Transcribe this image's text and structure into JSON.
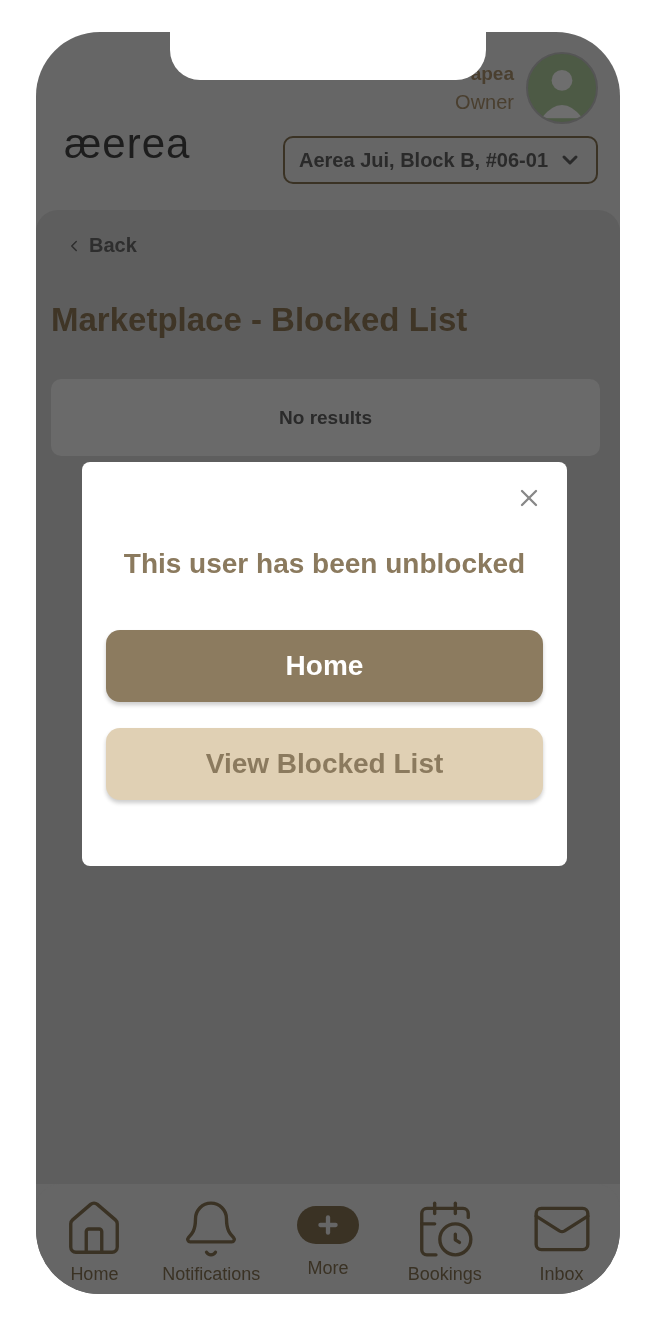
{
  "header": {
    "logo": "æerea",
    "user_name": "apea",
    "user_role": "Owner",
    "unit_selector": "Aerea Jui, Block B, #06-01"
  },
  "page": {
    "back": "Back",
    "title": "Marketplace - Blocked List",
    "empty_message": "No results"
  },
  "dialog": {
    "message": "This user has been unblocked",
    "buttons": [
      {
        "label": "Home",
        "kind": "primary"
      },
      {
        "label": "View Blocked List",
        "kind": "secondary"
      }
    ]
  },
  "nav": [
    {
      "label": "Home",
      "kind": "home"
    },
    {
      "label": "Notifications",
      "kind": "bell"
    },
    {
      "label": "More",
      "kind": "plus"
    },
    {
      "label": "Bookings",
      "kind": "calendar"
    },
    {
      "label": "Inbox",
      "kind": "mail"
    }
  ]
}
